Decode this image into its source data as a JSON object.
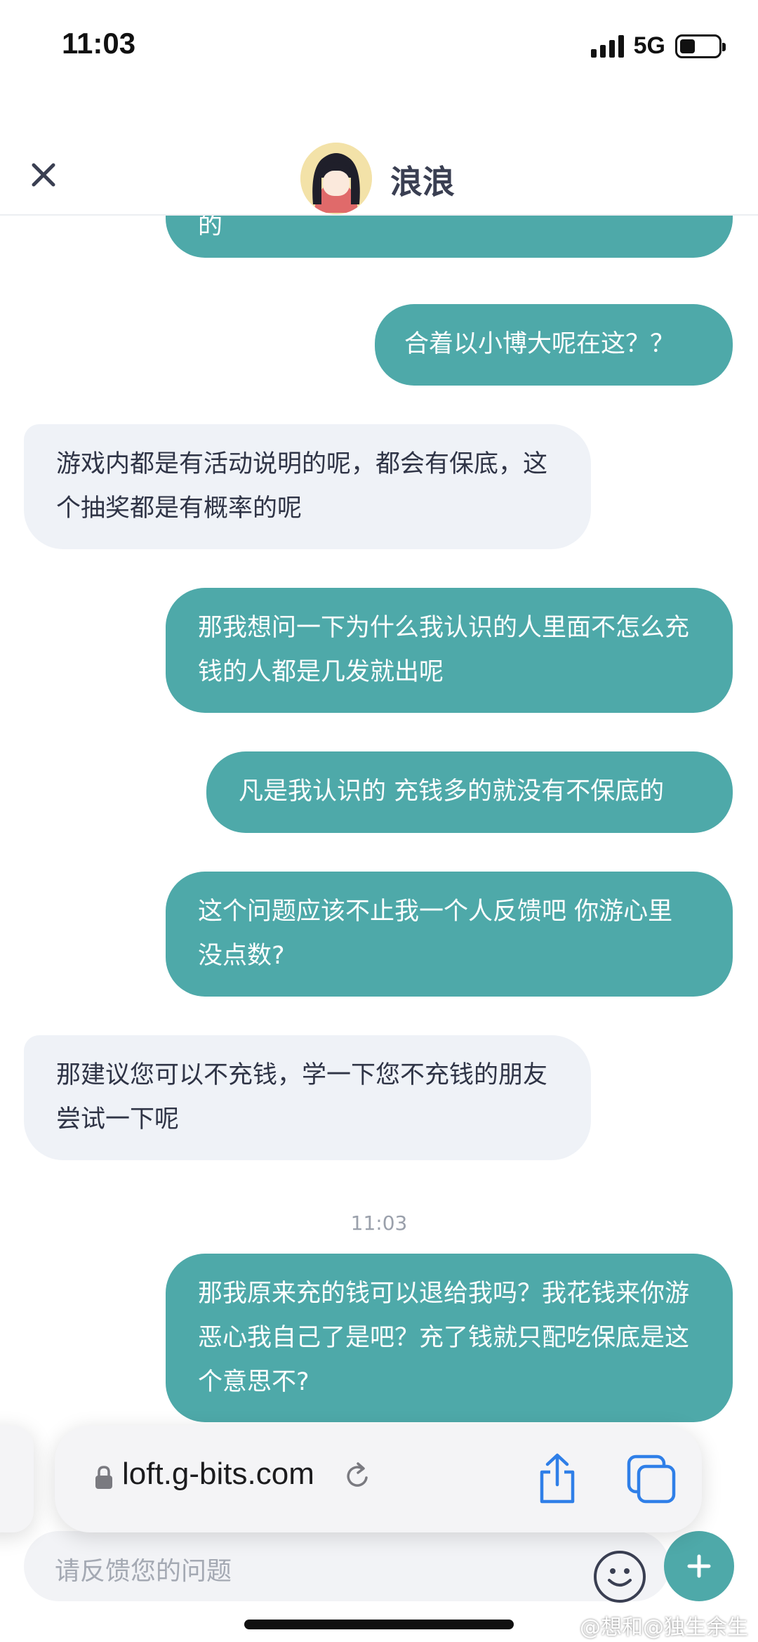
{
  "status_bar": {
    "time": "11:03",
    "network": "5G"
  },
  "header": {
    "title": "浪浪"
  },
  "messages": [
    {
      "side": "out",
      "text": "的"
    },
    {
      "side": "out",
      "text": "合着以小博大呢在这？？"
    },
    {
      "side": "in",
      "text": "游戏内都是有活动说明的呢，都会有保底，这个抽奖都是有概率的呢"
    },
    {
      "side": "out",
      "text": "那我想问一下为什么我认识的人里面不怎么充钱的人都是几发就出呢"
    },
    {
      "side": "out",
      "text": "凡是我认识的 充钱多的就没有不保底的"
    },
    {
      "side": "out",
      "text": "这个问题应该不止我一个人反馈吧 你游心里没点数?"
    },
    {
      "side": "in",
      "text": "那建议您可以不充钱，学一下您不充钱的朋友尝试一下呢"
    },
    {
      "side": "out",
      "text": "那我原来充的钱可以退给我吗？我花钱来你游恶心我自己了是吧？充了钱就只配吃保底是这个意思不?"
    }
  ],
  "timestamp": "11:03",
  "browser": {
    "url": "loft.g-bits.com"
  },
  "input": {
    "placeholder": "请反馈您的问题"
  },
  "watermark": "@想和@独生余生",
  "colors": {
    "accent": "#4ea9a9",
    "incoming_bubble": "#eff2f7"
  }
}
